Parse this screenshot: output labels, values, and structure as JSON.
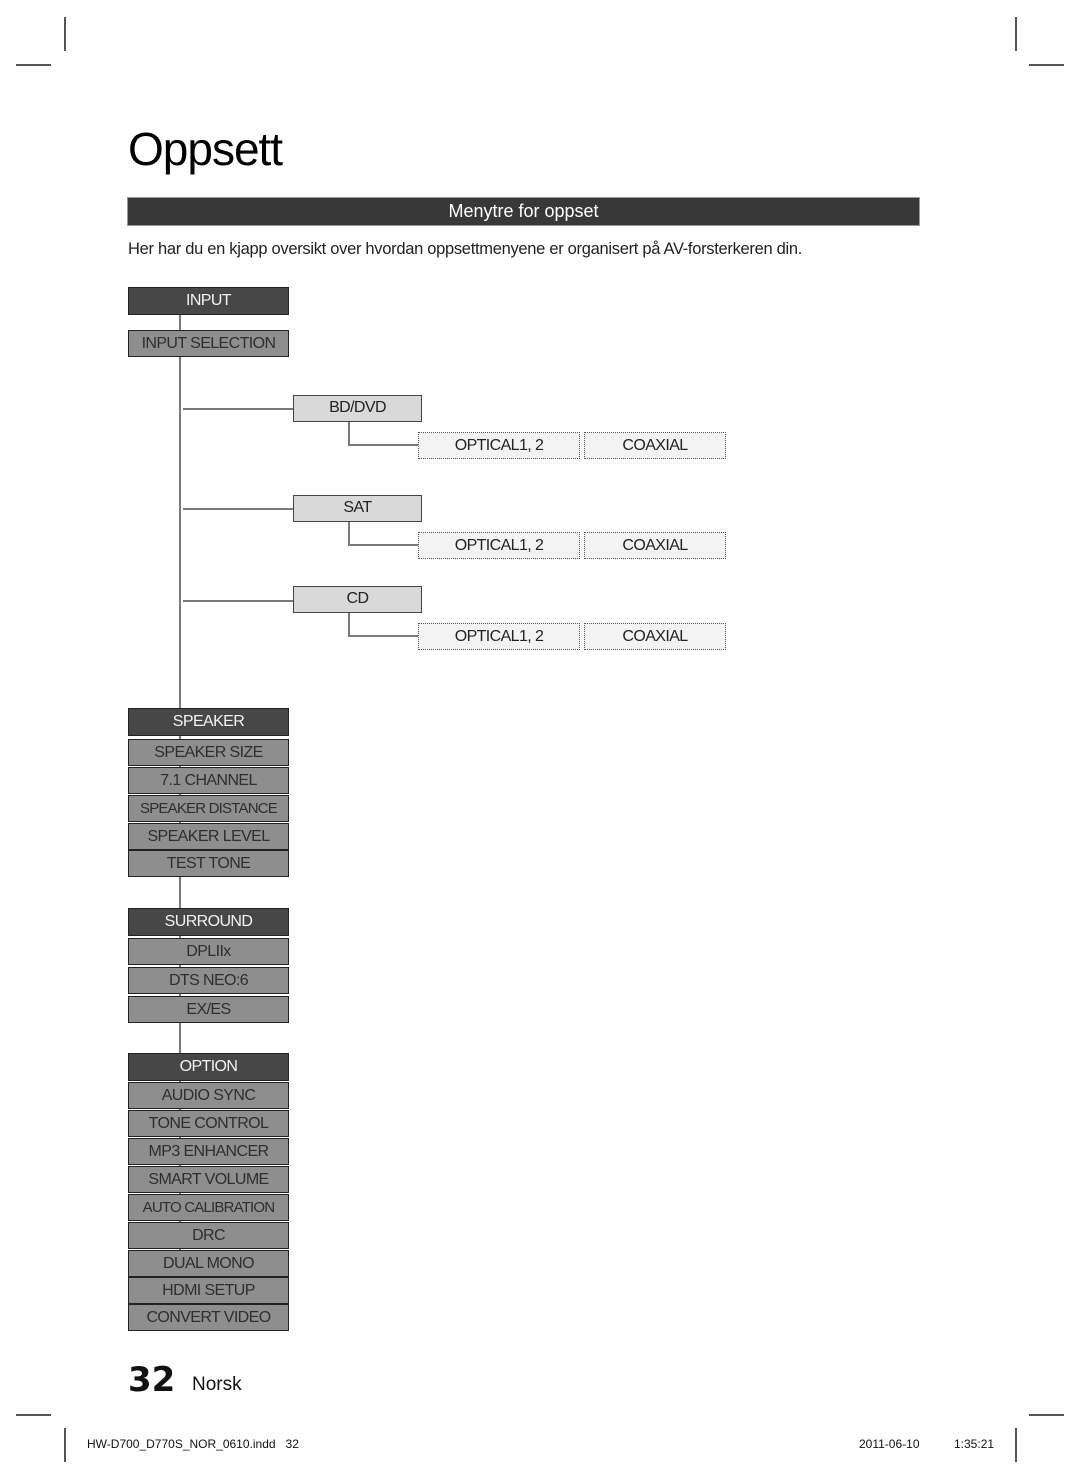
{
  "page": {
    "title": "Oppsett",
    "section_heading": "Menytre for oppset",
    "intro": "Her har du en kjapp oversikt over hvordan oppsettmenyene er organisert på AV-forsterkeren din.",
    "page_number": "32",
    "language": "Norsk"
  },
  "menu_tree": {
    "input": {
      "label": "INPUT",
      "selection": "INPUT SELECTION",
      "sources": [
        {
          "label": "BD/DVD",
          "options": [
            "OPTICAL1, 2",
            "COAXIAL"
          ]
        },
        {
          "label": "SAT",
          "options": [
            "OPTICAL1, 2",
            "COAXIAL"
          ]
        },
        {
          "label": "CD",
          "options": [
            "OPTICAL1, 2",
            "COAXIAL"
          ]
        }
      ]
    },
    "speaker": {
      "label": "SPEAKER",
      "items": [
        "SPEAKER SIZE",
        "7.1 CHANNEL",
        "SPEAKER DISTANCE",
        "SPEAKER LEVEL",
        "TEST TONE"
      ]
    },
    "surround": {
      "label": "SURROUND",
      "items": [
        "DPLIIx",
        "DTS NEO:6",
        "EX/ES"
      ]
    },
    "option": {
      "label": "OPTION",
      "items": [
        "AUDIO SYNC",
        "TONE CONTROL",
        "MP3 ENHANCER",
        "SMART VOLUME",
        "AUTO CALIBRATION",
        "DRC",
        "DUAL MONO",
        "HDMI SETUP",
        "CONVERT VIDEO"
      ]
    }
  },
  "footer": {
    "file": "HW-D700_D770S_NOR_0610.indd   32",
    "date": "2011-06-10",
    "time": "1:35:21"
  }
}
